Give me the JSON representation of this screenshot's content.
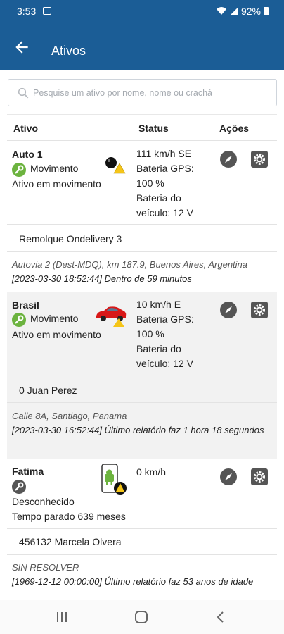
{
  "status_bar": {
    "time": "3:53",
    "battery": "92%"
  },
  "app_bar": {
    "title": "Ativos"
  },
  "search": {
    "placeholder": "Pesquise um ativo por nome, nome ou crachá"
  },
  "table": {
    "headers": {
      "asset": "Ativo",
      "status": "Status",
      "actions": "Ações"
    }
  },
  "assets": [
    {
      "name": "Auto 1",
      "state": "Movimento",
      "activity": "Ativo em movimento",
      "status": [
        "111 km/h SE",
        "Bateria GPS:",
        "100 %",
        "Bateria do",
        "veículo: 12 V"
      ],
      "driver": "Remolque Ondelivery 3",
      "location": "Autovia 2 (Dest-MDQ), km 187.9, Buenos Aires, Argentina",
      "message": "[2023-03-30 18:52:44] Dentro de 59 minutos"
    },
    {
      "name": "Brasil",
      "state": "Movimento",
      "activity": "Ativo em movimento",
      "status": [
        "10 km/h E",
        "Bateria GPS:",
        "100 %",
        "Bateria do",
        "veículo: 12 V"
      ],
      "driver": "0 Juan Perez",
      "location": "Calle 8A, Santiago, Panama",
      "message": "[2023-03-30 16:52:44] Último relatório faz 1 hora 18 segundos"
    },
    {
      "name": "Fatima",
      "state": "Desconhecido",
      "activity": "Tempo parado 639 meses",
      "status": [
        "0 km/h"
      ],
      "driver": "456132 Marcela Olvera",
      "location": "SIN RESOLVER",
      "message": "[1969-12-12 00:00:00] Último relatório faz 53 anos de idade"
    }
  ],
  "colors": {
    "primary": "#1b5d96",
    "moving": "#6cb33f",
    "unknown": "#555555",
    "warning": "#f5c518"
  }
}
